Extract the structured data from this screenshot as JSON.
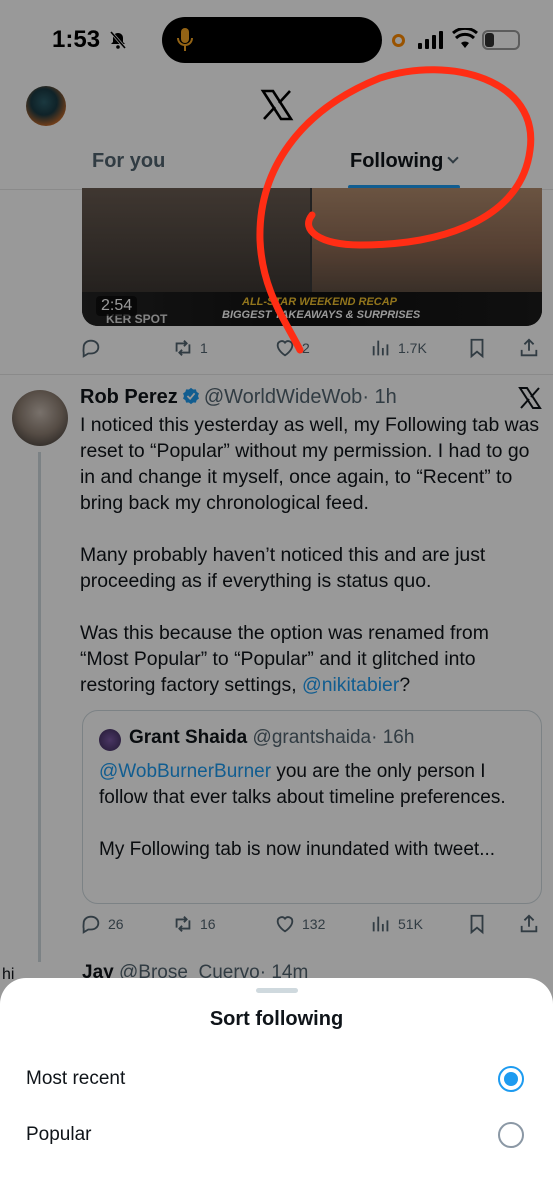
{
  "status_bar": {
    "time": "1:53",
    "battery": "27",
    "battery_level": 0.27
  },
  "header": {
    "logo": "x-logo"
  },
  "tabs": [
    {
      "label": "For you",
      "active": false
    },
    {
      "label": "Following",
      "active": true
    }
  ],
  "media_post": {
    "duration": "2:54",
    "banner_line1": "ALL-STAR WEEKEND RECAP",
    "banner_line2": "BIGGEST TAKEAWAYS & SURPRISES",
    "spot_text": "KER SPOT",
    "actions": {
      "reply": "",
      "repost": "1",
      "like": "2",
      "views": "1.7K"
    }
  },
  "tweet": {
    "name": "Rob Perez",
    "handle": "@WorldWideWob",
    "time": "· 1h",
    "paragraph1": "I noticed this yesterday as well, my Following tab was reset to “Popular” without my permission. I had to go in and change it myself, once again, to “Recent” to bring back my chronological feed.",
    "paragraph2": "Many probably haven’t noticed this and are just proceeding as if everything is status quo.",
    "paragraph3_text": "Was this because the option was renamed from “Most Popular” to “Popular” and it glitched into restoring factory settings, ",
    "paragraph3_mention": "@nikitabier",
    "paragraph3_end": "?",
    "quote": {
      "name": "Grant Shaida",
      "handle": "@grantshaida",
      "time": "· 16h",
      "mention": "@WobBurnerBurner",
      "text1": " you are the only person I follow that ever talks about timeline preferences.",
      "text2": "My Following tab is now inundated with tweet..."
    },
    "actions": {
      "reply": "26",
      "repost": "16",
      "like": "132",
      "views": "51K"
    }
  },
  "next_tweet": {
    "name": "Jay",
    "handle": "@Brose_Cuervo",
    "time": "· 14m",
    "left_fragment": "hi"
  },
  "sheet": {
    "title": "Sort following",
    "options": [
      {
        "label": "Most recent",
        "selected": true
      },
      {
        "label": "Popular",
        "selected": false
      }
    ]
  },
  "colors": {
    "accent": "#1d9bf0",
    "annotation": "#ff2d14"
  }
}
